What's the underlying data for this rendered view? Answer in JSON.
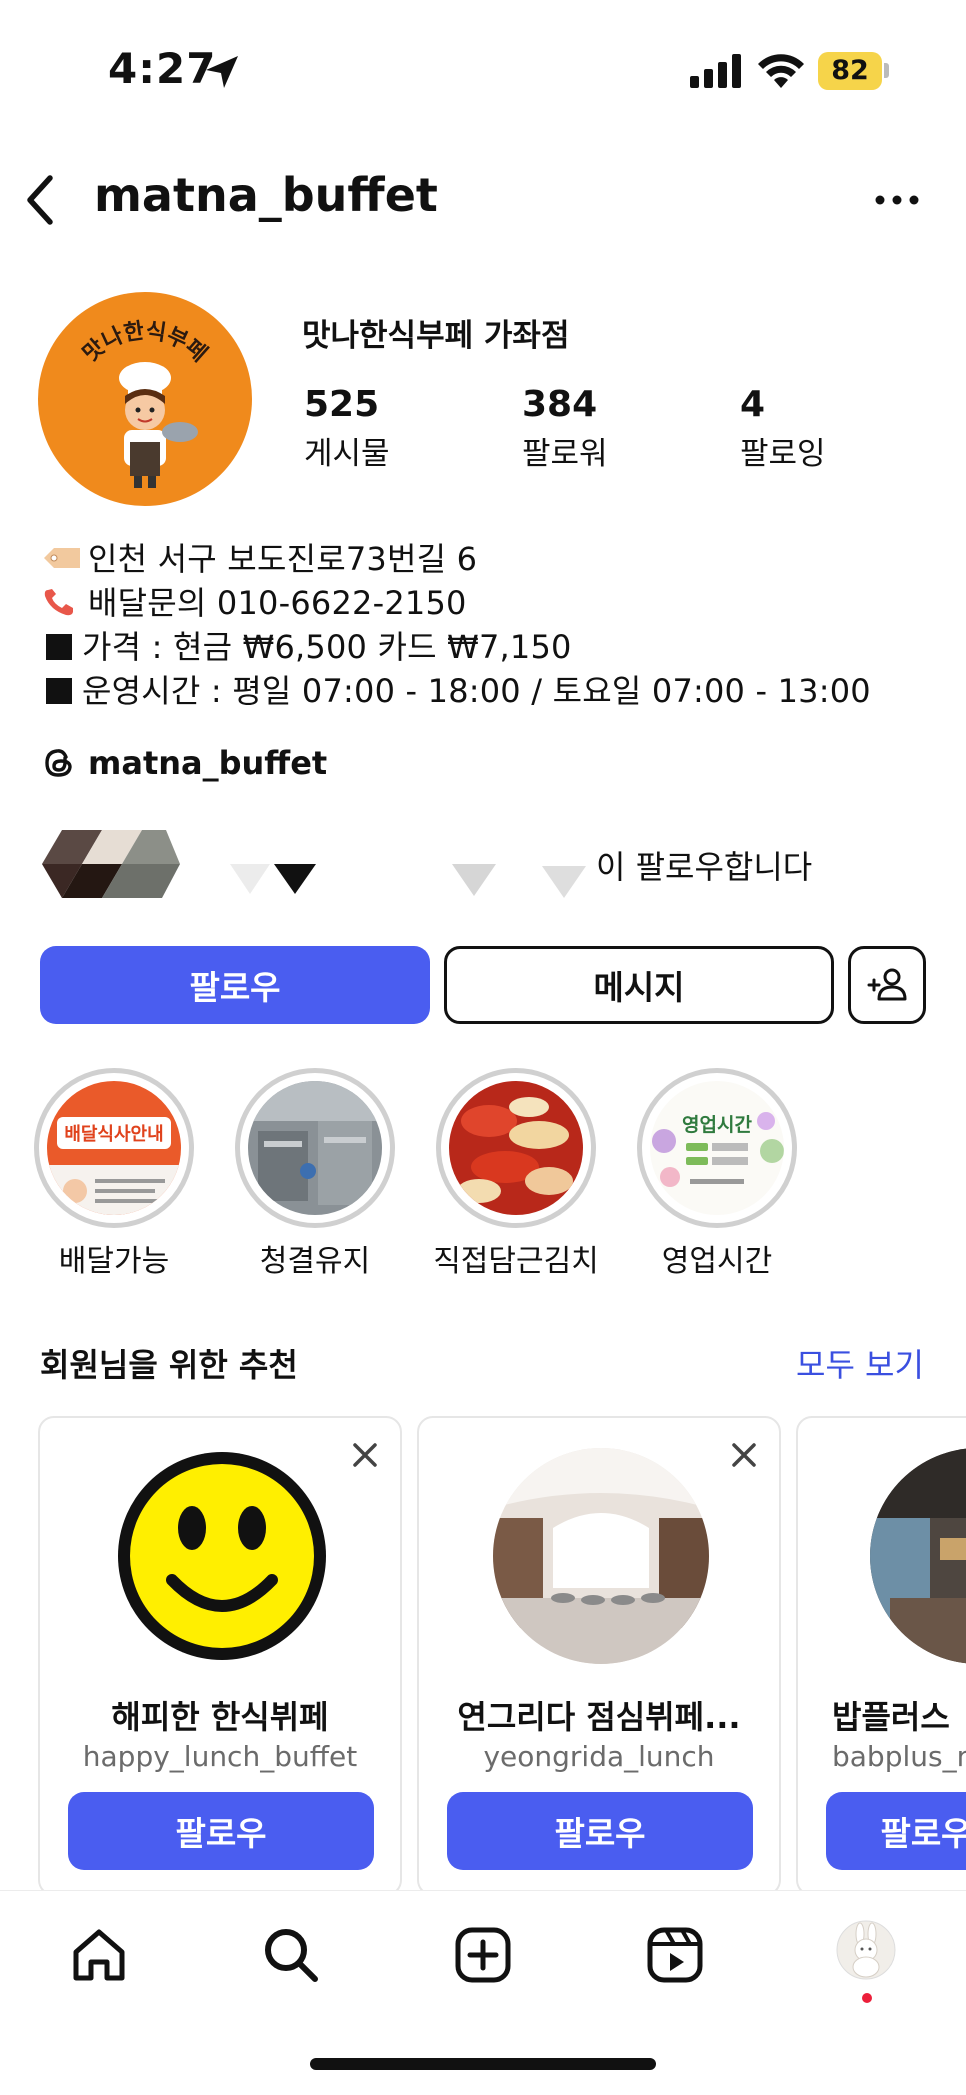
{
  "status_bar": {
    "time": "4:27",
    "battery": "82"
  },
  "header": {
    "username": "matna_buffet"
  },
  "profile": {
    "avatar_text": "맛나한식부페",
    "display_name": "맛나한식부페 가좌점",
    "stats": [
      {
        "value": "525",
        "label": "게시물"
      },
      {
        "value": "384",
        "label": "팔로워"
      },
      {
        "value": "4",
        "label": "팔로잉"
      }
    ],
    "bio": [
      "인천 서구 보도진로73번길 6",
      "배달문의 010-6622-2150",
      "가격 : 현금 ₩6,500 카드 ₩7,150",
      "운영시간 : 평일 07:00 - 18:00 / 토요일 07:00 - 13:00"
    ],
    "threads_handle": "matna_buffet",
    "followed_by_text": "이 팔로우합니다"
  },
  "actions": {
    "follow": "팔로우",
    "message": "메시지"
  },
  "highlights": [
    {
      "label": "배달가능",
      "image_text": "배달식사안내"
    },
    {
      "label": "청결유지"
    },
    {
      "label": "직접담근김치"
    },
    {
      "label": "영업시간",
      "image_text": "영업시간"
    }
  ],
  "suggestions": {
    "title": "회원님을 위한 추천",
    "see_all": "모두 보기",
    "cards": [
      {
        "name": "해피한 한식뷔페",
        "handle": "happy_lunch_buffet",
        "button": "팔로우"
      },
      {
        "name": "연그리다 점심뷔페...",
        "handle": "yeongrida_lunch",
        "button": "팔로우"
      },
      {
        "name": "밥플러스",
        "handle": "babplus_m",
        "button": "팔로우"
      }
    ]
  },
  "colors": {
    "accent": "#4a5df0",
    "link": "#3a4fe0",
    "battery": "#f6d44a",
    "avatar_bg": "#f08a1c"
  }
}
